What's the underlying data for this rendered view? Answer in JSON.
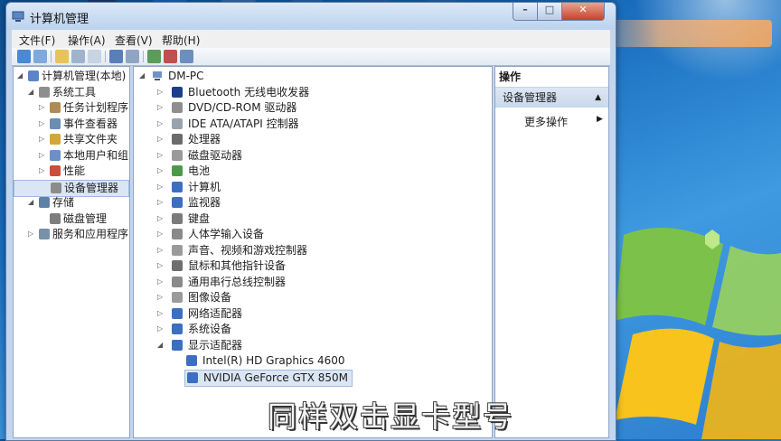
{
  "window": {
    "title": "计算机管理"
  },
  "menu": [
    "文件(F)",
    "操作(A)",
    "查看(V)",
    "帮助(H)"
  ],
  "left_tree": [
    {
      "label": "计算机管理(本地)",
      "level": 0,
      "expanded": true,
      "icon": "computer-manage-icon"
    },
    {
      "label": "系统工具",
      "level": 1,
      "expanded": true,
      "icon": "tools-icon"
    },
    {
      "label": "任务计划程序",
      "level": 2,
      "expanded": false,
      "icon": "clock-icon"
    },
    {
      "label": "事件查看器",
      "level": 2,
      "expanded": false,
      "icon": "event-viewer-icon"
    },
    {
      "label": "共享文件夹",
      "level": 2,
      "expanded": false,
      "icon": "shared-folder-icon"
    },
    {
      "label": "本地用户和组",
      "level": 2,
      "expanded": false,
      "icon": "users-icon"
    },
    {
      "label": "性能",
      "level": 2,
      "expanded": false,
      "icon": "performance-icon"
    },
    {
      "label": "设备管理器",
      "level": 2,
      "expanded": null,
      "icon": "device-manager-icon",
      "selected": true
    },
    {
      "label": "存储",
      "level": 1,
      "expanded": true,
      "icon": "storage-icon"
    },
    {
      "label": "磁盘管理",
      "level": 2,
      "expanded": null,
      "icon": "disk-icon"
    },
    {
      "label": "服务和应用程序",
      "level": 1,
      "expanded": false,
      "icon": "services-icon"
    }
  ],
  "device_tree": {
    "root": "DM-PC",
    "categories": [
      {
        "label": "Bluetooth 无线电收发器",
        "icon": "bluetooth-icon"
      },
      {
        "label": "DVD/CD-ROM 驱动器",
        "icon": "dvd-icon"
      },
      {
        "label": "IDE ATA/ATAPI 控制器",
        "icon": "ide-icon"
      },
      {
        "label": "处理器",
        "icon": "processor-icon"
      },
      {
        "label": "磁盘驱动器",
        "icon": "disk-drive-icon"
      },
      {
        "label": "电池",
        "icon": "battery-icon"
      },
      {
        "label": "计算机",
        "icon": "computer-icon"
      },
      {
        "label": "监视器",
        "icon": "monitor-icon"
      },
      {
        "label": "键盘",
        "icon": "keyboard-icon"
      },
      {
        "label": "人体学输入设备",
        "icon": "hid-icon"
      },
      {
        "label": "声音、视频和游戏控制器",
        "icon": "sound-icon"
      },
      {
        "label": "鼠标和其他指针设备",
        "icon": "mouse-icon"
      },
      {
        "label": "通用串行总线控制器",
        "icon": "usb-icon"
      },
      {
        "label": "图像设备",
        "icon": "camera-icon"
      },
      {
        "label": "网络适配器",
        "icon": "network-icon"
      },
      {
        "label": "系统设备",
        "icon": "system-device-icon"
      },
      {
        "label": "显示适配器",
        "icon": "display-adapter-icon",
        "expanded": true
      }
    ],
    "display_children": [
      "Intel(R) HD Graphics 4600",
      "NVIDIA GeForce GTX 850M"
    ]
  },
  "actions": {
    "header": "操作",
    "section": "设备管理器",
    "more": "更多操作"
  },
  "subtitle": "同样双击显卡型号"
}
